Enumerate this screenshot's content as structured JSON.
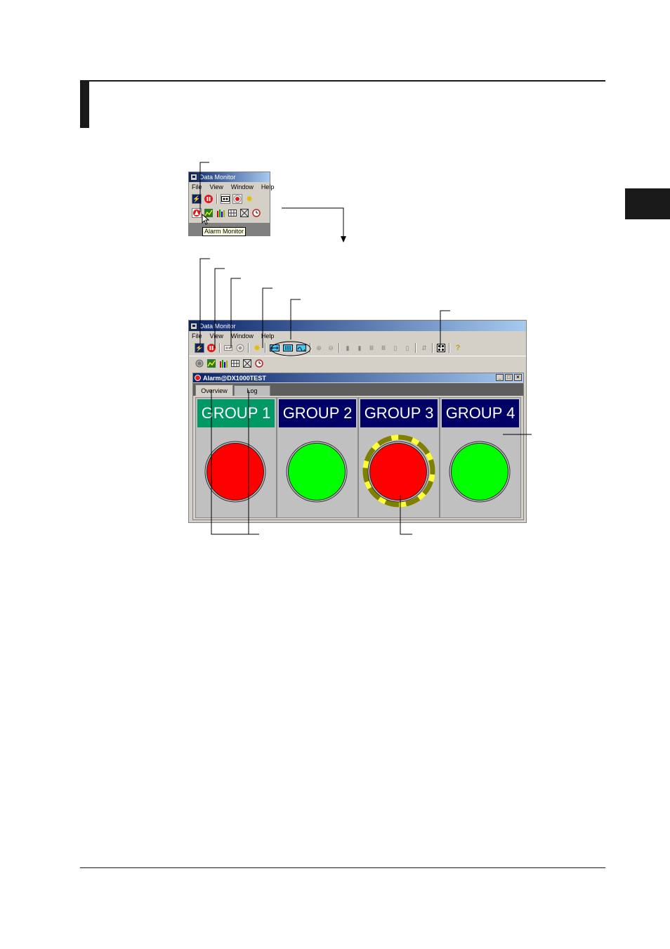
{
  "colors": {
    "titlebar_start": "#0a246a",
    "titlebar_end": "#a6caf0",
    "group_normal_head": "#000066",
    "group_selected_head": "#009966",
    "lamp_alarm": "#ff0000",
    "lamp_ok": "#00ff00",
    "blink_ring_a": "#ffff33",
    "blink_ring_b": "#808000"
  },
  "small_window": {
    "title": "Data Monitor",
    "menu": [
      "File",
      "View",
      "Window",
      "Help"
    ],
    "toolbar1_icons": [
      "lightning-icon",
      "pause-icon",
      "tape-icon",
      "record-icon",
      "star-burst-icon"
    ],
    "toolbar2_icons": [
      "alarm-monitor-icon",
      "trend-icon",
      "bar-graph-icon",
      "digital-icon",
      "overview-icon",
      "clock-icon"
    ],
    "tooltip": "Alarm Monitor"
  },
  "main_window": {
    "title": "Data Monitor",
    "menu": [
      "File",
      "View",
      "Window",
      "Help"
    ],
    "child": {
      "title": "Alarm@DX1000TEST",
      "tabs": [
        {
          "label": "Overview",
          "selected": true
        },
        {
          "label": "Log",
          "selected": false
        }
      ],
      "groups": [
        {
          "label": "GROUP 1",
          "status": "alarm",
          "selected": true,
          "blinking": false
        },
        {
          "label": "GROUP 2",
          "status": "ok",
          "selected": false,
          "blinking": false
        },
        {
          "label": "GROUP 3",
          "status": "alarm",
          "selected": false,
          "blinking": true
        },
        {
          "label": "GROUP 4",
          "status": "ok",
          "selected": false,
          "blinking": false
        }
      ]
    }
  }
}
